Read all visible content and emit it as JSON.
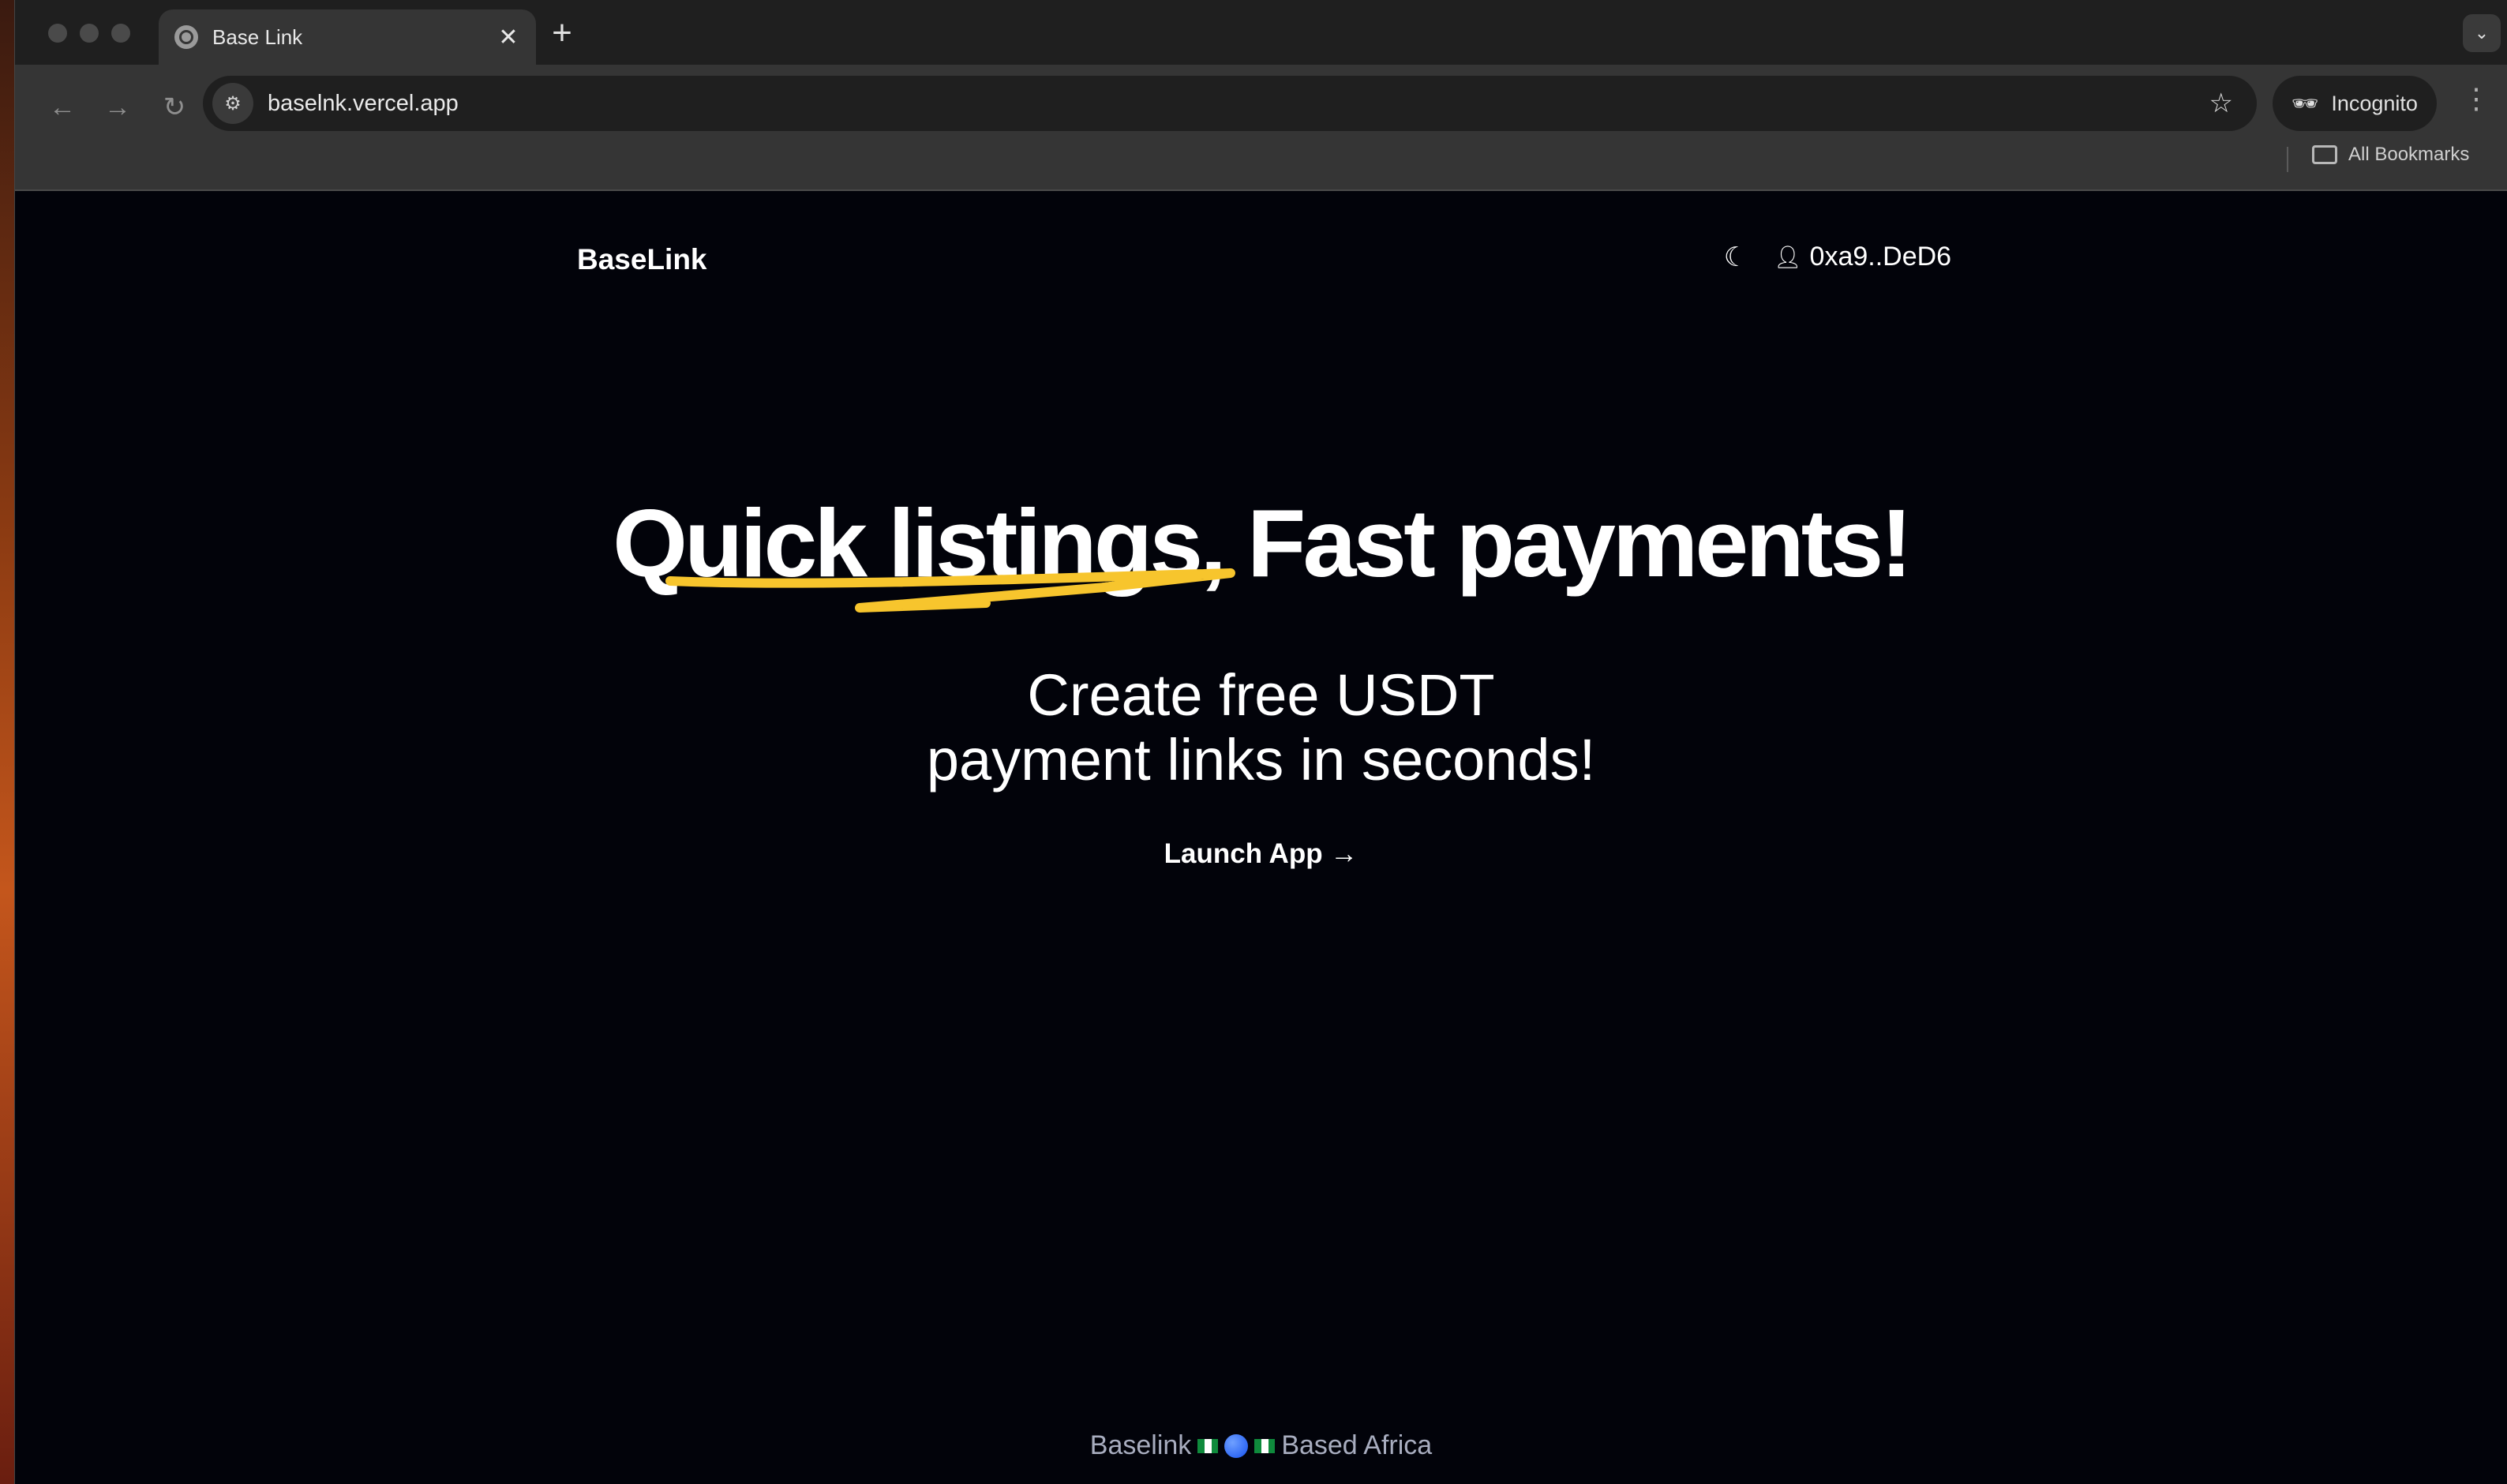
{
  "browser": {
    "tab_title": "Base Link",
    "new_tab_icon": "plus-icon",
    "url": "baselnk.vercel.app",
    "incognito_label": "Incognito",
    "bookmarks_label": "All Bookmarks"
  },
  "header": {
    "logo": "BaseLink",
    "account": "0xa9..DeD6"
  },
  "hero": {
    "headline_part1": "Quick listings,",
    "headline_part2": "Fast payments!",
    "subtitle_line1": "Create free USDT",
    "subtitle_line2": "payment links in seconds!",
    "cta": "Launch App →"
  },
  "footer": {
    "left": "Baselink",
    "right": "Based Africa"
  },
  "colors": {
    "page_bg": "#02030a",
    "accent_underline": "#f7c52d",
    "footer_text": "#a8adbf"
  }
}
